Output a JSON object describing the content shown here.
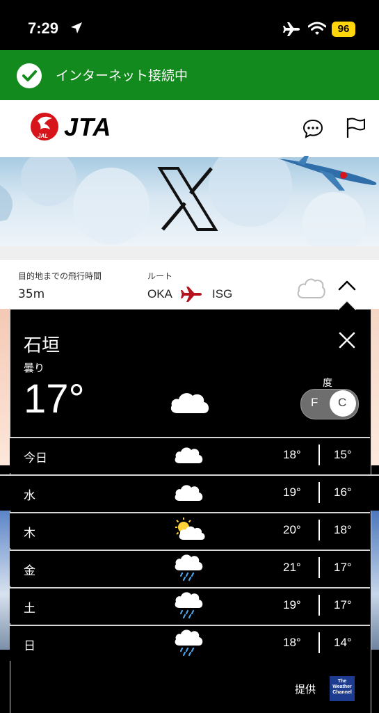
{
  "status_bar": {
    "time": "7:29",
    "battery": "96"
  },
  "banner": {
    "text": "インターネット接続中"
  },
  "header": {
    "brand": "JTA",
    "logo_text": "JAL"
  },
  "flight": {
    "duration_label": "目的地までの飛行時間",
    "duration_value": "35m",
    "route_label": "ルート",
    "origin": "OKA",
    "destination": "ISG"
  },
  "weather": {
    "city": "石垣",
    "condition": "曇り",
    "current_temp": "17°",
    "unit_label": "度",
    "unit_f": "F",
    "unit_c": "C",
    "selected_unit": "C",
    "forecast": [
      {
        "day": "今日",
        "icon": "cloud-icon",
        "high": "18°",
        "low": "15°"
      },
      {
        "day": "水",
        "icon": "cloud-icon",
        "high": "19°",
        "low": "16°"
      },
      {
        "day": "木",
        "icon": "partly-sunny-icon",
        "high": "20°",
        "low": "18°"
      },
      {
        "day": "金",
        "icon": "rain-icon",
        "high": "21°",
        "low": "17°"
      },
      {
        "day": "土",
        "icon": "rain-icon",
        "high": "19°",
        "low": "17°"
      },
      {
        "day": "日",
        "icon": "rain-icon",
        "high": "18°",
        "low": "14°"
      }
    ],
    "provider_label": "提供",
    "provider_logo_text": [
      "The",
      "Weather",
      "Channel"
    ]
  },
  "colors": {
    "banner_green": "#138a1e",
    "jal_red": "#d7141a",
    "battery_yellow": "#ffd60a",
    "twc_blue": "#1e3c8f"
  }
}
